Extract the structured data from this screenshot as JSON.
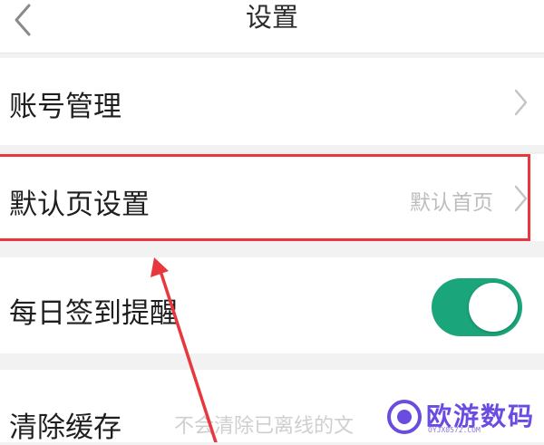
{
  "header": {
    "title": "设置",
    "back_icon": "chevron-left-icon"
  },
  "settings": {
    "account": {
      "label": "账号管理",
      "icon": "chevron-right-icon"
    },
    "default_page": {
      "label": "默认页设置",
      "value": "默认首页",
      "icon": "chevron-right-icon"
    },
    "checkin": {
      "label": "每日签到提醒",
      "toggle_on": true
    },
    "cache": {
      "label": "清除缓存",
      "hint": "不会清除已离线的文"
    }
  },
  "annotation": {
    "highlight_color": "#e8383e",
    "arrow_color": "#e8383e"
  },
  "watermark": {
    "text": "欧游数码",
    "sub": "OYJX0572.COM",
    "color": "#6a4ce0"
  },
  "colors": {
    "toggle_on": "#1aa57a",
    "background": "#f2f2f2"
  }
}
